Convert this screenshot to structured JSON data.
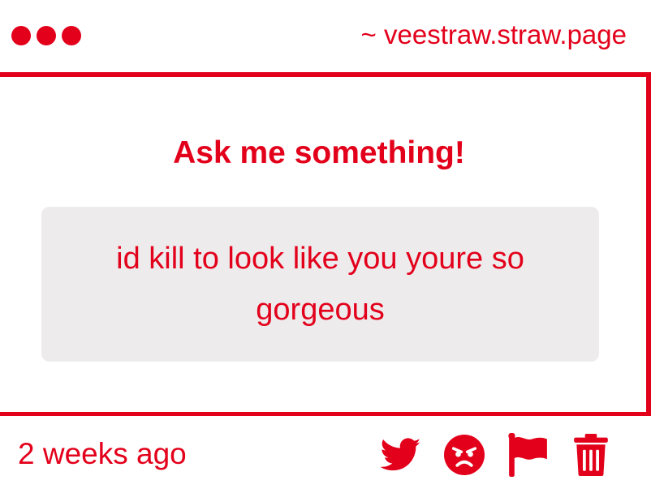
{
  "window": {
    "url": "~ veestraw.straw.page"
  },
  "main": {
    "heading": "Ask me something!",
    "question": "id kill to look like you youre so gorgeous"
  },
  "footer": {
    "timestamp": "2 weeks ago",
    "actions": [
      {
        "icon": "twitter-icon"
      },
      {
        "icon": "angry-face-icon"
      },
      {
        "icon": "flag-icon"
      },
      {
        "icon": "trash-icon"
      }
    ]
  },
  "colors": {
    "accent": "#e3001b",
    "question_bg": "#edebec",
    "background": "#ffffff"
  }
}
